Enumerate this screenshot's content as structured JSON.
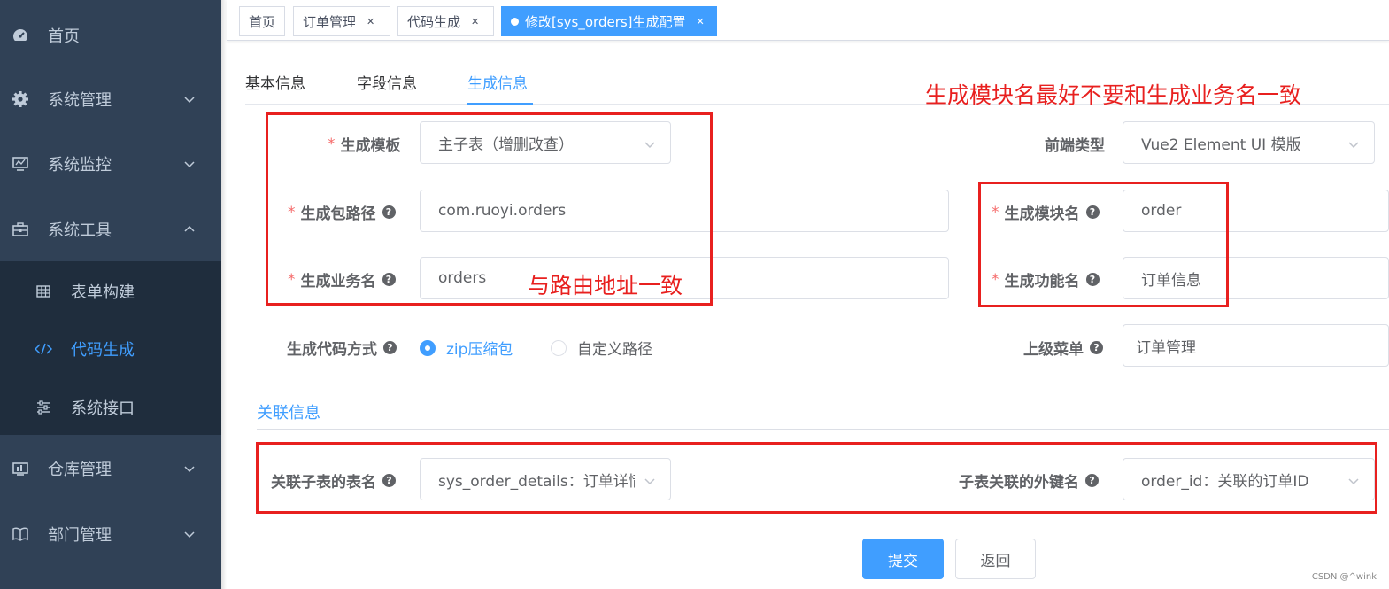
{
  "sidebar": {
    "items": [
      {
        "label": "首页",
        "icon": "dashboard-icon"
      },
      {
        "label": "系统管理",
        "icon": "gear-icon"
      },
      {
        "label": "系统监控",
        "icon": "monitor-icon"
      },
      {
        "label": "系统工具",
        "icon": "toolbox-icon"
      },
      {
        "label": "仓库管理",
        "icon": "warehouse-icon"
      },
      {
        "label": "部门管理",
        "icon": "book-icon"
      }
    ],
    "sub_items": [
      {
        "label": "表单构建",
        "icon": "table-icon"
      },
      {
        "label": "代码生成",
        "icon": "code-icon"
      },
      {
        "label": "系统接口",
        "icon": "sliders-icon"
      }
    ]
  },
  "tags": [
    {
      "label": "首页"
    },
    {
      "label": "订单管理"
    },
    {
      "label": "代码生成"
    },
    {
      "label": "修改[sys_orders]生成配置"
    }
  ],
  "tabs": [
    "基本信息",
    "字段信息",
    "生成信息"
  ],
  "form": {
    "template": {
      "label": "生成模板",
      "value": "主子表（增删改查）"
    },
    "package": {
      "label": "生成包路径",
      "value": "com.ruoyi.orders"
    },
    "business": {
      "label": "生成业务名",
      "value": "orders"
    },
    "frontend": {
      "label": "前端类型",
      "value": "Vue2 Element UI 模版"
    },
    "module": {
      "label": "生成模块名",
      "value": "order"
    },
    "function": {
      "label": "生成功能名",
      "value": "订单信息"
    },
    "gen_type": {
      "label": "生成代码方式",
      "option1": "zip压缩包",
      "option2": "自定义路径"
    },
    "parent_menu": {
      "label": "上级菜单",
      "value": "订单管理"
    }
  },
  "relation": {
    "title": "关联信息",
    "sub_table": {
      "label": "关联子表的表名",
      "value": "sys_order_details：订单详情"
    },
    "fk": {
      "label": "子表关联的外键名",
      "value": "order_id：关联的订单ID"
    }
  },
  "buttons": {
    "submit": "提交",
    "back": "返回"
  },
  "annotations": {
    "top_note": "生成模块名最好不要和生成业务名一致",
    "route_note": "与路由地址一致"
  },
  "watermark": "CSDN @^wink",
  "colors": {
    "primary": "#409eff",
    "sidebar": "#304156",
    "annotation": "#e8201f",
    "required": "#f56c6c"
  }
}
